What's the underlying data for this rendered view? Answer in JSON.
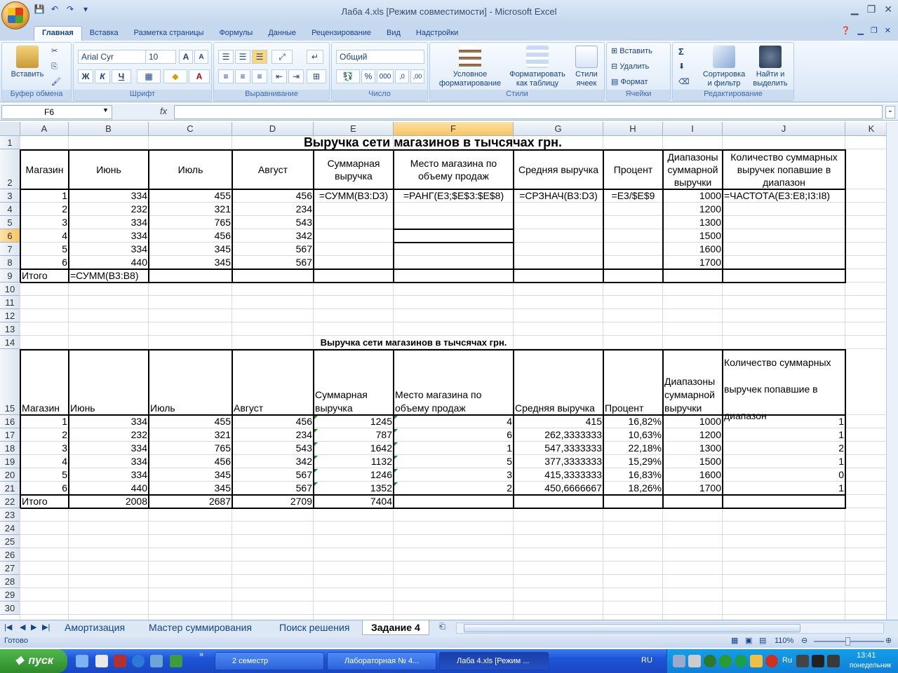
{
  "window": {
    "title": "Лаба 4.xls  [Режим совместимости] - Microsoft Excel"
  },
  "qat": {
    "more": "▾"
  },
  "tabs": [
    "Главная",
    "Вставка",
    "Разметка страницы",
    "Формулы",
    "Данные",
    "Рецензирование",
    "Вид",
    "Надстройки"
  ],
  "ribbon": {
    "clipboard": {
      "paste": "Вставить",
      "name": "Буфер обмена"
    },
    "font": {
      "family": "Arial Cyr",
      "size": "10",
      "bold": "Ж",
      "italic": "К",
      "underline": "Ч",
      "grow": "A",
      "shrink": "A",
      "name": "Шрифт"
    },
    "alignment": {
      "name": "Выравнивание"
    },
    "number": {
      "format": "Общий",
      "percent": "%",
      "thousands": "000",
      "inc": ",0",
      "dec": ",00",
      "name": "Число"
    },
    "styles": {
      "conditional": "Условное форматирование",
      "as_table": "Форматировать как таблицу",
      "cell_styles": "Стили ячеек",
      "name": "Стили"
    },
    "cells": {
      "insert": "Вставить",
      "delete": "Удалить",
      "format": "Формат",
      "name": "Ячейки"
    },
    "editing": {
      "sum": "Σ",
      "sort": "Сортировка и фильтр",
      "find": "Найти и выделить",
      "name": "Редактирование"
    }
  },
  "formula_bar": {
    "name_box": "F6",
    "fx": "fx",
    "formula": ""
  },
  "columns": [
    "A",
    "B",
    "C",
    "D",
    "E",
    "F",
    "G",
    "H",
    "I",
    "J",
    "K"
  ],
  "rows": [
    "1",
    "2",
    "3",
    "4",
    "5",
    "6",
    "7",
    "8",
    "9",
    "10",
    "11",
    "12",
    "13",
    "14",
    "15",
    "16",
    "17",
    "18",
    "19",
    "20",
    "21",
    "22",
    "23",
    "24",
    "25",
    "26",
    "27",
    "28",
    "29",
    "30"
  ],
  "table1": {
    "title": "Выручка сети магазинов в тычсячах грн.",
    "headers": [
      "Магазин",
      "Июнь",
      "Июль",
      "Август",
      "Суммарная выручка",
      "Место магазина по объему продаж",
      "Средняя выручка",
      "Процент",
      "Диапазоны суммарной выручки",
      "Количество суммарных выручек попавшие в диапазон"
    ],
    "rows": [
      [
        "1",
        "334",
        "455",
        "456",
        "=СУММ(B3:D3)",
        "=РАНГ(E3;$E$3:$E$8)",
        "=СРЗНАЧ(B3:D3)",
        "=E3/$E$9",
        "1000",
        "=ЧАСТОТА(E3:E8;I3:I8)"
      ],
      [
        "2",
        "232",
        "321",
        "234",
        "",
        "",
        "",
        "",
        "1200",
        ""
      ],
      [
        "3",
        "334",
        "765",
        "543",
        "",
        "",
        "",
        "",
        "1300",
        ""
      ],
      [
        "4",
        "334",
        "456",
        "342",
        "",
        "",
        "",
        "",
        "1500",
        ""
      ],
      [
        "5",
        "334",
        "345",
        "567",
        "",
        "",
        "",
        "",
        "1600",
        ""
      ],
      [
        "6",
        "440",
        "345",
        "567",
        "",
        "",
        "",
        "",
        "1700",
        ""
      ]
    ],
    "total_label": "Итого",
    "total_formula": "=СУММ(B3:B8)"
  },
  "table2": {
    "title": "Выручка сети магазинов в тычсячах грн.",
    "headers": [
      "Магазин",
      "Июнь",
      "Июль",
      "Август",
      "Суммарная выручка",
      "Место магазина по объему продаж",
      "Средняя выручка",
      "Процент",
      "Диапазоны суммарной выручки",
      "Количество суммарных выручек попавшие в диапазон"
    ],
    "rows": [
      [
        "1",
        "334",
        "455",
        "456",
        "1245",
        "4",
        "415",
        "16,82%",
        "1000",
        "1"
      ],
      [
        "2",
        "232",
        "321",
        "234",
        "787",
        "6",
        "262,3333333",
        "10,63%",
        "1200",
        "1"
      ],
      [
        "3",
        "334",
        "765",
        "543",
        "1642",
        "1",
        "547,3333333",
        "22,18%",
        "1300",
        "2"
      ],
      [
        "4",
        "334",
        "456",
        "342",
        "1132",
        "5",
        "377,3333333",
        "15,29%",
        "1500",
        "1"
      ],
      [
        "5",
        "334",
        "345",
        "567",
        "1246",
        "3",
        "415,3333333",
        "16,83%",
        "1600",
        "0"
      ],
      [
        "6",
        "440",
        "345",
        "567",
        "1352",
        "2",
        "450,6666667",
        "18,26%",
        "1700",
        "1"
      ]
    ],
    "totals": [
      "Итого",
      "2008",
      "2687",
      "2709",
      "7404"
    ]
  },
  "sheet_tabs": [
    "Амортизация",
    "Мастер суммирования",
    "Поиск решения",
    "Задание 4"
  ],
  "status": {
    "ready": "Готово",
    "zoom": "110%"
  },
  "taskbar": {
    "start": "пуск",
    "items": [
      "2 семестр",
      "Лабораторная № 4...",
      "Лаба 4.xls  [Режим ..."
    ],
    "lang": "RU",
    "tray_text": "Ru",
    "time": "13:41",
    "day": "понедельник"
  }
}
